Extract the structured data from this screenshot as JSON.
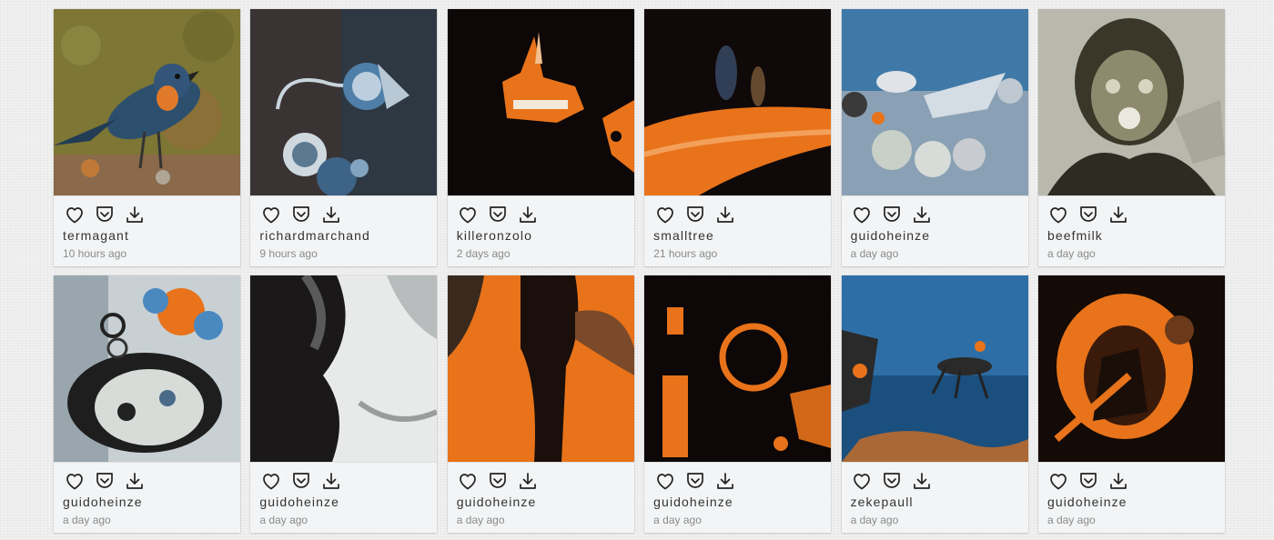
{
  "gallery": {
    "items": [
      {
        "user": "termagant",
        "time": "10 hours ago"
      },
      {
        "user": "richardmarchand",
        "time": "9 hours ago"
      },
      {
        "user": "killeronzolo",
        "time": "2 days ago"
      },
      {
        "user": "smalltree",
        "time": "21 hours ago"
      },
      {
        "user": "guidoheinze",
        "time": "a day ago"
      },
      {
        "user": "beefmilk",
        "time": "a day ago"
      },
      {
        "user": "guidoheinze",
        "time": "a day ago"
      },
      {
        "user": "guidoheinze",
        "time": "a day ago"
      },
      {
        "user": "guidoheinze",
        "time": "a day ago"
      },
      {
        "user": "guidoheinze",
        "time": "a day ago"
      },
      {
        "user": "zekepaull",
        "time": "a day ago"
      },
      {
        "user": "guidoheinze",
        "time": "a day ago"
      }
    ]
  },
  "icons": {
    "like": "heart-icon",
    "save": "pocket-icon",
    "download": "download-icon"
  },
  "colors": {
    "card_bg": "#f3f4f5",
    "username": "#333333",
    "timestamp": "#8a8a8a",
    "accent_orange": "#e8731a"
  }
}
